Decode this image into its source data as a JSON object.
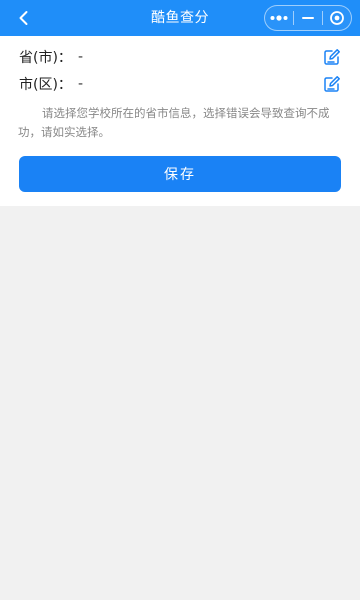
{
  "navbar": {
    "title": "酷鱼查分",
    "back_icon": "chevron-left-icon",
    "capsule": {
      "more_icon": "more-dots-icon",
      "minimize_icon": "minimize-icon",
      "close_icon": "target-circle-icon"
    }
  },
  "form": {
    "province": {
      "label": "省(市)：",
      "value": "-"
    },
    "district": {
      "label": "市(区)：",
      "value": "-"
    },
    "edit_icon": "edit-icon"
  },
  "notice": "请选择您学校所在的省市信息，选择错误会导致查询不成功，请如实选择。",
  "save_label": "保存",
  "colors": {
    "navbar_bg": "#1f8ef9",
    "primary_button": "#1a82f5",
    "page_bg": "#f1f1f1",
    "edit_icon": "#1a82f5"
  }
}
